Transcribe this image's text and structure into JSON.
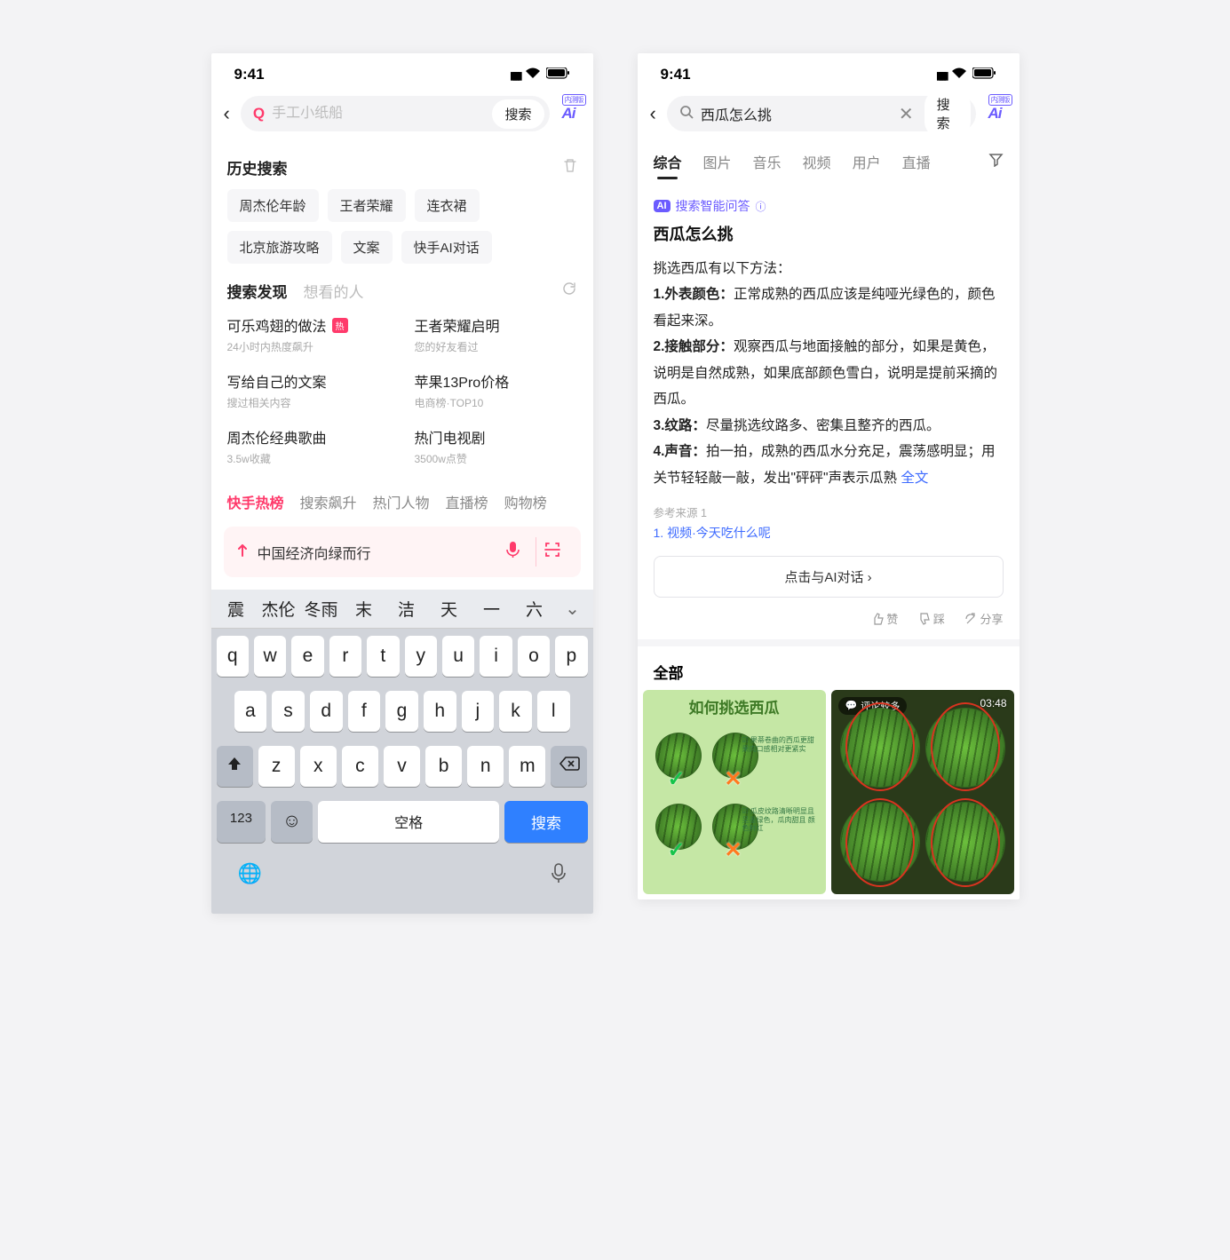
{
  "status": {
    "time": "9:41"
  },
  "left": {
    "search": {
      "placeholder": "手工小纸船",
      "button": "搜索",
      "ai_label": "Ai"
    },
    "history": {
      "title": "历史搜索",
      "chips": [
        "周杰伦年龄",
        "王者荣耀",
        "连衣裙",
        "北京旅游攻略",
        "文案",
        "快手AI对话"
      ]
    },
    "discover": {
      "tabs": [
        "搜索发现",
        "想看的人"
      ],
      "items": [
        {
          "title": "可乐鸡翅的做法",
          "badge": "热",
          "sub": "24小时内热度飙升"
        },
        {
          "title": "王者荣耀启明",
          "sub": "您的好友看过"
        },
        {
          "title": "写给自己的文案",
          "sub": "搜过相关内容"
        },
        {
          "title": "苹果13Pro价格",
          "sub": "电商榜·TOP10"
        },
        {
          "title": "周杰伦经典歌曲",
          "sub": "3.5w收藏"
        },
        {
          "title": "热门电视剧",
          "sub": "3500w点赞"
        }
      ]
    },
    "hot_tabs": [
      "快手热榜",
      "搜索飙升",
      "热门人物",
      "直播榜",
      "购物榜"
    ],
    "trend": "中国经济向绿而行",
    "candidates": [
      "震",
      "杰伦",
      "冬雨",
      "末",
      "洁",
      "天",
      "一",
      "六"
    ],
    "kb": {
      "row1": [
        "q",
        "w",
        "e",
        "r",
        "t",
        "y",
        "u",
        "i",
        "o",
        "p"
      ],
      "row2": [
        "a",
        "s",
        "d",
        "f",
        "g",
        "h",
        "j",
        "k",
        "l"
      ],
      "row3": [
        "z",
        "x",
        "c",
        "v",
        "b",
        "n",
        "m"
      ],
      "num": "123",
      "space": "空格",
      "action": "搜索"
    }
  },
  "right": {
    "search": {
      "value": "西瓜怎么挑",
      "button": "搜索",
      "ai_label": "Ai"
    },
    "tabs": [
      "综合",
      "图片",
      "音乐",
      "视频",
      "用户",
      "直播"
    ],
    "ai": {
      "badge": "AI",
      "label": "搜索智能问答",
      "question": "西瓜怎么挑",
      "intro": "挑选西瓜有以下方法：",
      "points": [
        {
          "k": "1.外表颜色：",
          "v": "正常成熟的西瓜应该是纯哑光绿色的，颜色看起来深。"
        },
        {
          "k": "2.接触部分：",
          "v": "观察西瓜与地面接触的部分，如果是黄色，说明是自然成熟，如果底部颜色雪白，说明是提前采摘的西瓜。"
        },
        {
          "k": "3.纹路：",
          "v": "尽量挑选纹路多、密集且整齐的西瓜。"
        },
        {
          "k": "4.声音：",
          "v": "拍一拍，成熟的西瓜水分充足，震荡感明显；用关节轻轻敲一敲，发出\"砰砰\"声表示瓜熟"
        }
      ],
      "full": "全文",
      "src_label": "参考来源 1",
      "src_link": "1. 视频·今天吃什么呢",
      "chat_btn": "点击与AI对话 ›",
      "actions": {
        "like": "赞",
        "dislike": "踩",
        "share": "分享"
      }
    },
    "all": {
      "title": "全部",
      "card1_title": "如何挑选西瓜",
      "card2_badge": "评论较多",
      "card2_time": "03:48"
    }
  }
}
